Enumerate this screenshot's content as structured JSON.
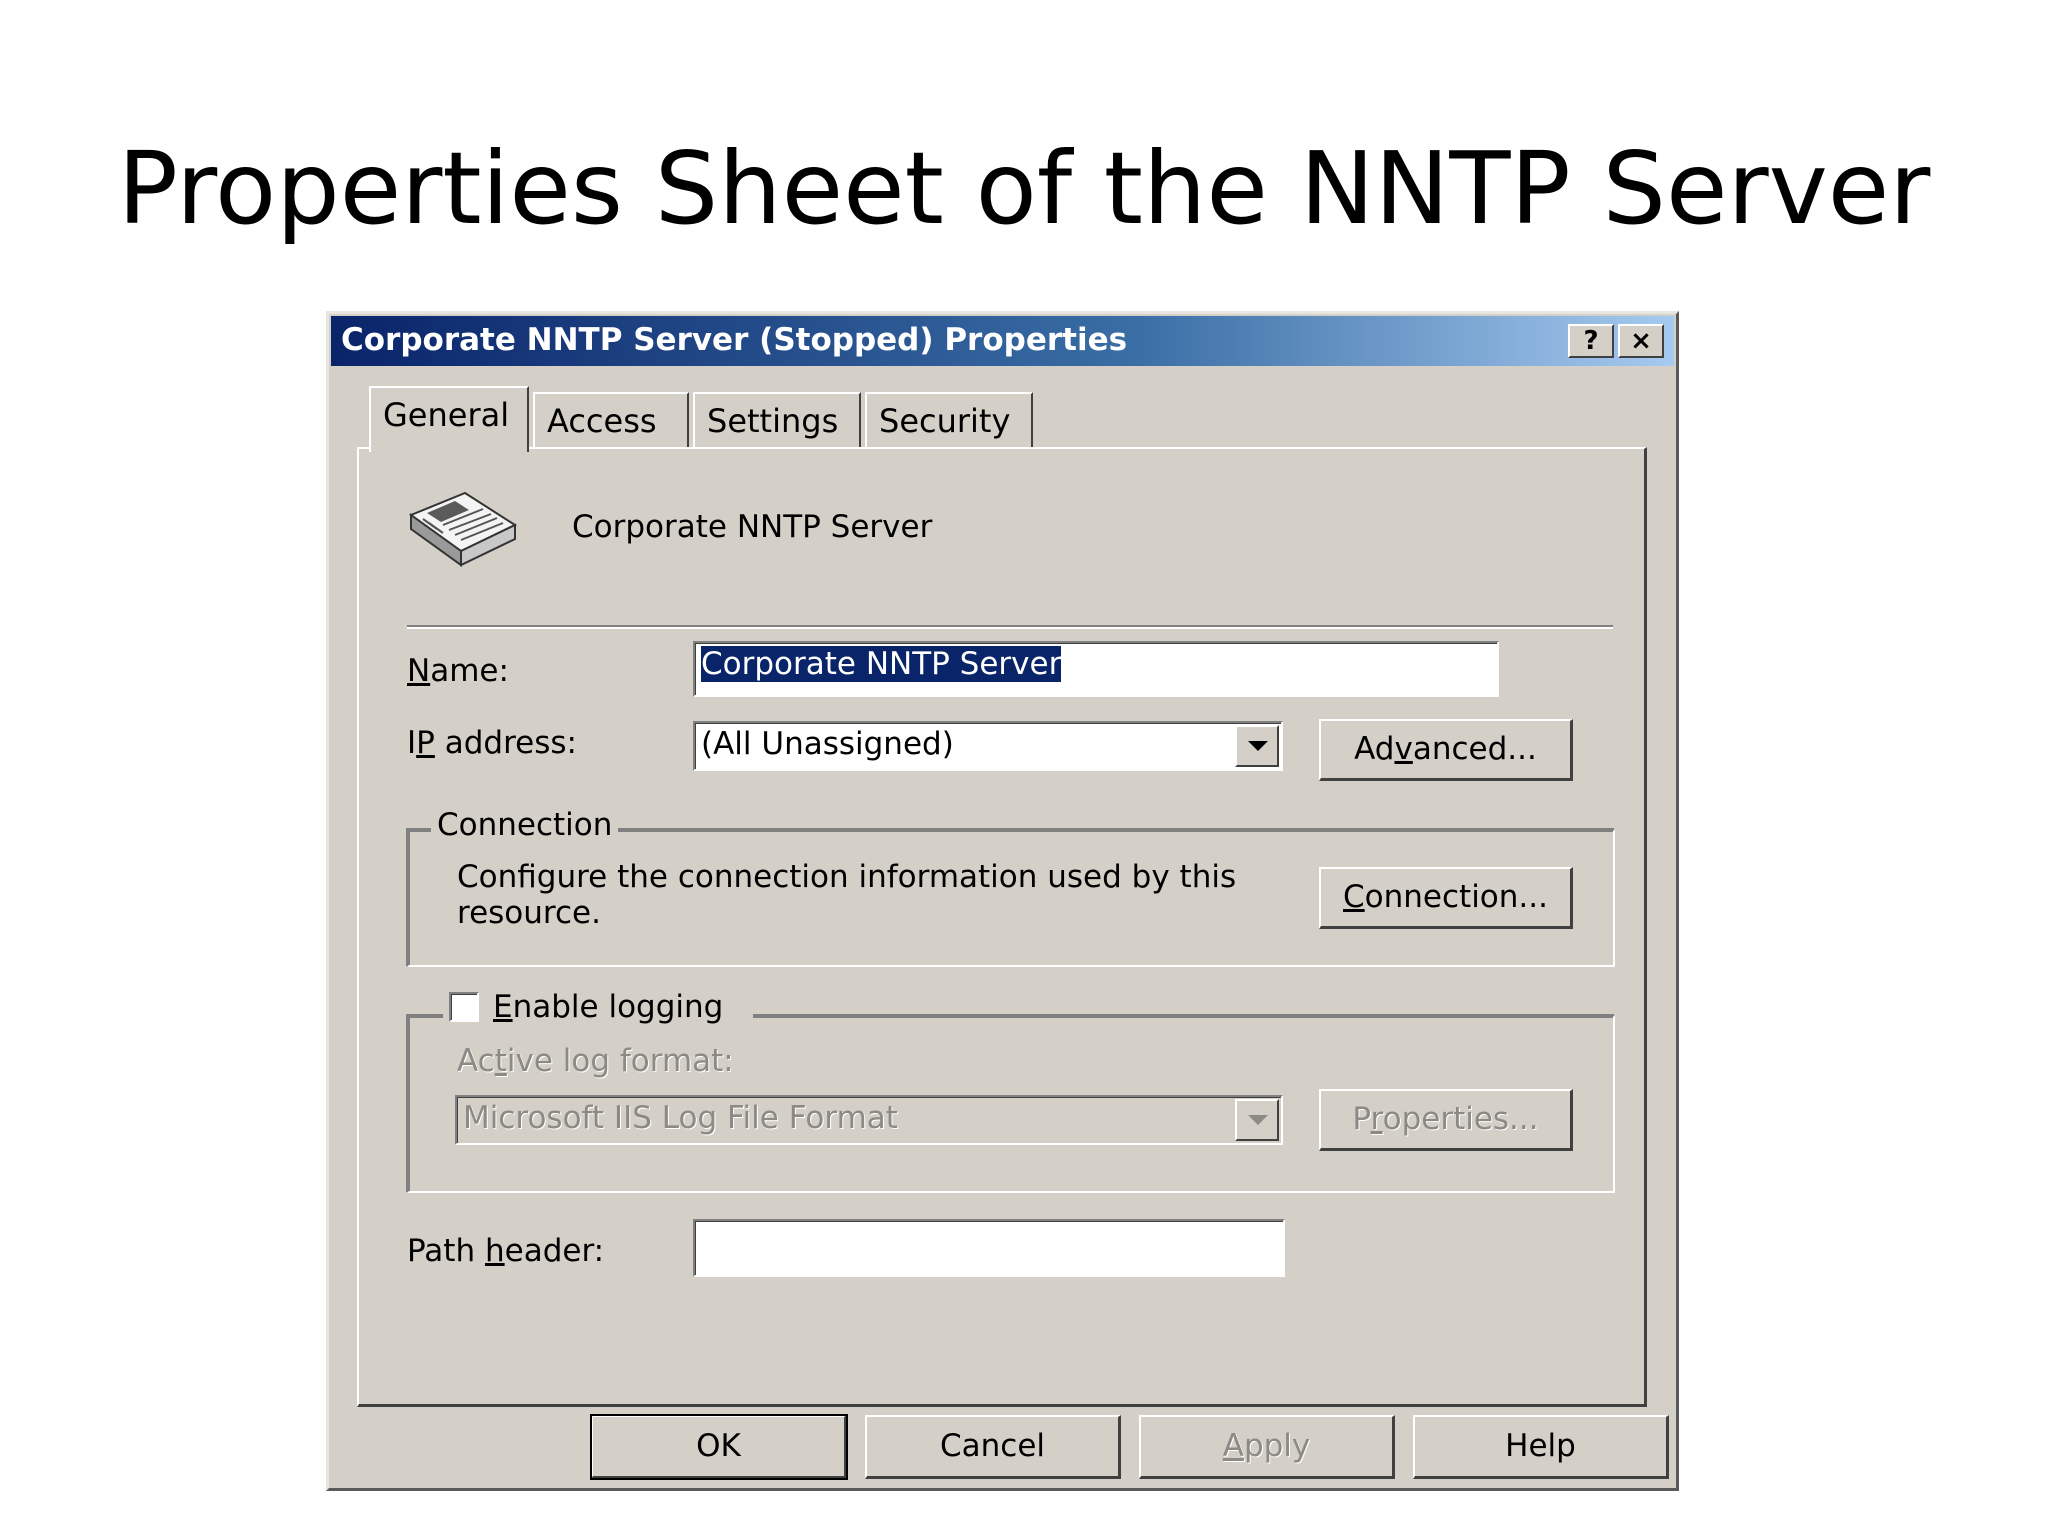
{
  "slide": {
    "title": "Properties Sheet of the NNTP Server"
  },
  "window": {
    "title": "Corporate NNTP Server (Stopped) Properties",
    "help_btn": "?",
    "close_btn": "×"
  },
  "tabs": [
    {
      "label": "General",
      "active": true
    },
    {
      "label": "Access",
      "active": false
    },
    {
      "label": "Settings",
      "active": false
    },
    {
      "label": "Security",
      "active": false
    }
  ],
  "header": {
    "server_name": "Corporate NNTP Server",
    "icon": "newspaper-icon"
  },
  "name_field": {
    "label_pre": "",
    "label_ul": "N",
    "label_post": "ame:",
    "value": "Corporate NNTP Server"
  },
  "ip_field": {
    "label_pre": "I",
    "label_ul": "P",
    "label_post": " address:",
    "value": "(All Unassigned)"
  },
  "advanced_btn": {
    "pre": "Ad",
    "ul": "v",
    "post": "anced..."
  },
  "connection_group": {
    "legend": "Connection",
    "description": "Configure the connection information used by this resource.",
    "button_pre": "",
    "button_ul": "C",
    "button_post": "onnection..."
  },
  "logging_group": {
    "checkbox_pre": "",
    "checkbox_ul": "E",
    "checkbox_post": "nable logging",
    "checked": false,
    "format_label_pre": "Ac",
    "format_label_ul": "t",
    "format_label_post": "ive log format:",
    "format_value": "Microsoft IIS Log File Format",
    "properties_pre": "P",
    "properties_ul": "r",
    "properties_post": "operties..."
  },
  "path_field": {
    "label_pre": "Path ",
    "label_ul": "h",
    "label_post": "eader:",
    "value": ""
  },
  "footer": {
    "ok": "OK",
    "cancel": "Cancel",
    "apply_ul": "A",
    "apply_post": "pply",
    "help": "Help"
  },
  "colors": {
    "titlebar_start": "#0a246a",
    "titlebar_end": "#a6caf0",
    "dialog_bg": "#d4d0c8",
    "selection": "#0a246a"
  }
}
